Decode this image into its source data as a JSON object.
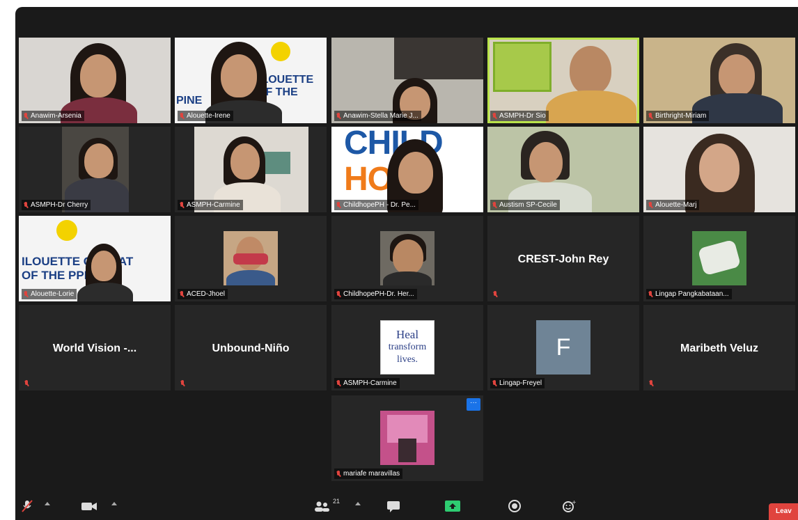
{
  "participants": {
    "p1": "Anawim-Arsenia",
    "p2": "Alouette-Irene",
    "p3": "Anawim-Stella Marie J...",
    "p4": "ASMPH-Dr Sio",
    "p5": "Birthright-Miriam",
    "p6": "ASMPH-Dr Cherry",
    "p7": "ASMPH-Carmine",
    "p8": "ChildhopePH - Dr. Pe...",
    "p9": "Austism SP-Cecile",
    "p10": "Alouette-Marj",
    "p11": "Alouette-Lorie",
    "p12": "ACED-Jhoel",
    "p13": "ChildhopePH-Dr. Her...",
    "p14": "CREST-John Rey",
    "p15": "Lingap Pangkabataan...",
    "p16": "World Vision -...",
    "p17": "Unbound-Niño",
    "p18": "ASMPH-Carmine",
    "p19": "Lingap-Freyel",
    "p20": "Maribeth Veluz",
    "p21": "mariafe maravillas"
  },
  "tiles": {
    "alouette_logo_line1": "ILOUETTE",
    "alouette_logo_line2": "OF THE",
    "alouette_logo_line3": "PINE",
    "alouette2_logo_line1": "ILOUETTE  OUNDAT",
    "alouette2_logo_line2": "OF THE  PPINE",
    "childhope_line1": "CHILD",
    "childhope_line2": "HO    E",
    "heal_line1": "Heal",
    "heal_line2": "transform",
    "heal_line3": "lives.",
    "avatar_letter": "F"
  },
  "toolbar": {
    "participant_count": "21",
    "leave_label": "Leav"
  },
  "colors": {
    "active_speaker": "#b9e34a",
    "muted_red": "#e0443e",
    "tile_bg": "#262626",
    "leave_red": "#e0443e",
    "share_green": "#2ecc71"
  }
}
